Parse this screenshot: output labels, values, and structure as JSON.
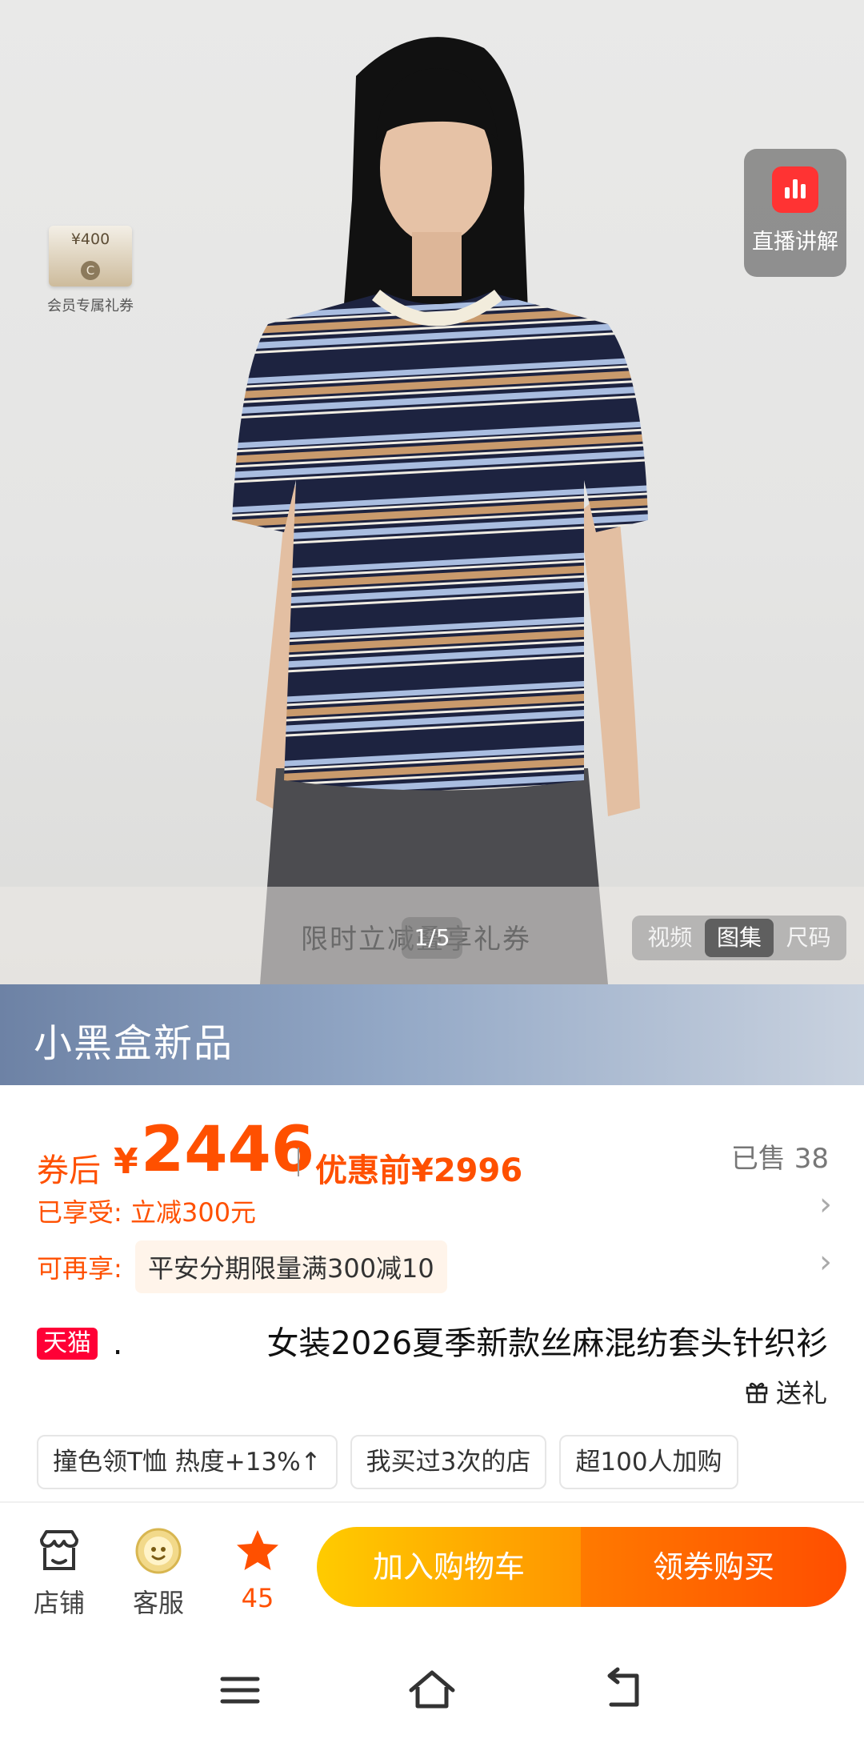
{
  "hero": {
    "voucher": {
      "amount": "¥400",
      "seal": "C",
      "caption": "会员专属礼券"
    },
    "live_button": {
      "label": "直播讲解"
    },
    "promo_overlay": "限时立减叠享礼券",
    "counter": "1/5",
    "media_tabs": [
      {
        "label": "视频",
        "active": false
      },
      {
        "label": "图集",
        "active": true
      },
      {
        "label": "尺码",
        "active": false
      }
    ]
  },
  "banner": {
    "text": "小黑盒新品"
  },
  "price": {
    "after_coupon_label": "券后",
    "currency": "¥",
    "amount": "2446",
    "original_label": "优惠前¥2996",
    "sold": "已售 38"
  },
  "benefits": {
    "enjoyed_label": "已享受:",
    "enjoyed_value": "立减300元",
    "more_label": "可再享:",
    "more_value": "平安分期限量满300减10"
  },
  "product": {
    "platform_badge": "天猫",
    "title_prefix": ".",
    "title": "女装2026夏季新款丝麻混纺套头针织衫",
    "gift_label": "送礼"
  },
  "tags": [
    {
      "label": "撞色领T恤 热度+13%↑"
    },
    {
      "label": "我买过3次的店"
    },
    {
      "label": "超100人加购"
    }
  ],
  "action_bar": {
    "store": "店铺",
    "service": "客服",
    "favorites": "45",
    "add_to_cart": "加入购物车",
    "buy": "领券购买"
  },
  "colors": {
    "accent": "#ff5000",
    "tmall": "#ff0036",
    "cart_gradient": [
      "#ffcb00",
      "#ff9500"
    ],
    "buy_gradient": [
      "#ff7a00",
      "#ff4e00"
    ]
  }
}
